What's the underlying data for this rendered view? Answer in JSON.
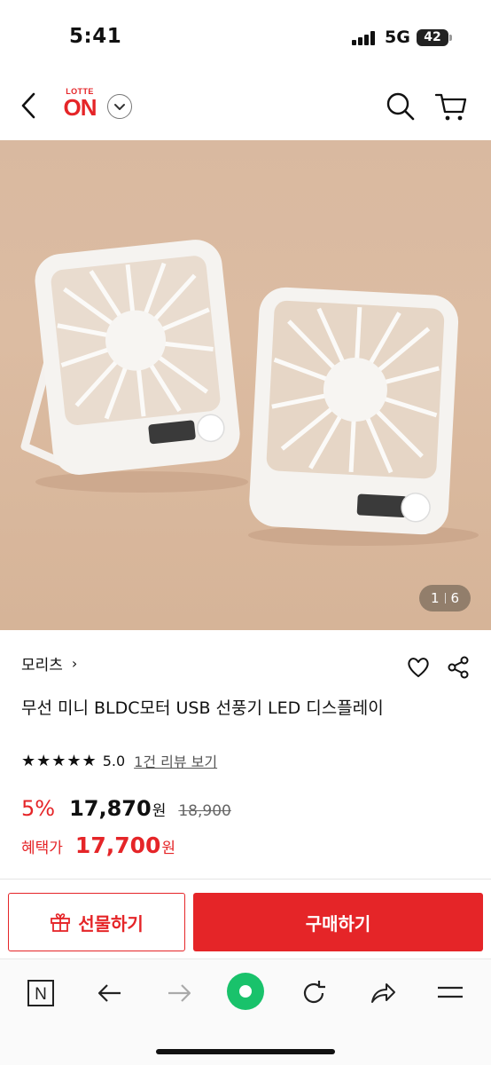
{
  "status": {
    "time": "5:41",
    "network": "5G",
    "battery": "42"
  },
  "header": {
    "logo_top": "LOTTE",
    "logo_main": "ON"
  },
  "gallery": {
    "current": "1",
    "total": "6"
  },
  "product": {
    "brand": "모리츠",
    "title": "무선 미니 BLDC모터 USB 선풍기 LED 디스플레이",
    "rating": "5.0",
    "rating_stars": 5,
    "review_link": "1건 리뷰 보기",
    "discount": "5%",
    "price": "17,870",
    "price_unit": "원",
    "original_price": "18,900",
    "benefit_label": "혜택가",
    "benefit_price": "17,700",
    "benefit_unit": "원"
  },
  "actions": {
    "gift": "선물하기",
    "buy": "구매하기"
  },
  "colors": {
    "accent": "#e52528",
    "active_toolbar": "#19c26b"
  },
  "toolbar": [
    "naver-n-icon",
    "back-arrow-icon",
    "forward-arrow-icon",
    "green-dot-icon",
    "refresh-icon",
    "share-arrow-icon",
    "menu-icon"
  ]
}
